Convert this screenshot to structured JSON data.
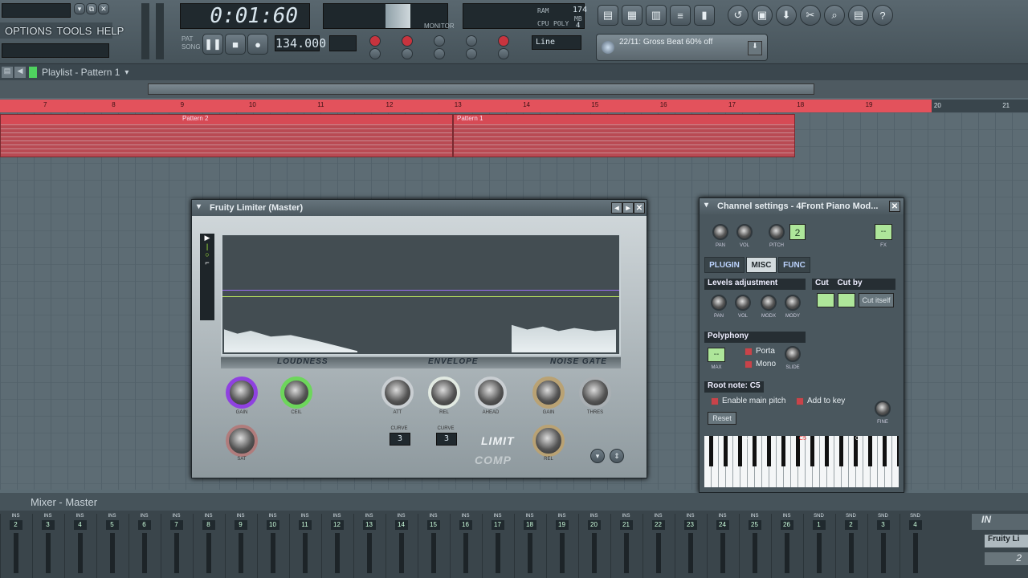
{
  "menu": {
    "options": "OPTIONS",
    "tools": "TOOLS",
    "help": "HELP"
  },
  "transport": {
    "time": "0:01:60",
    "tempo": "134.000",
    "pat_label": "PAT",
    "song_label": "SONG",
    "snap": "Line",
    "cpu_value": "174",
    "poly_value": "4",
    "ram_label": "RAM",
    "cpu_label": "CPU",
    "poly_label": "POLY",
    "mb_label": "MB",
    "hint_text": "22/11: Gross Beat 60% off",
    "monitor_label": "MONITOR"
  },
  "playlist": {
    "title": "Playlist - Pattern 1",
    "ruler": [
      "7",
      "8",
      "9",
      "10",
      "11",
      "12",
      "13",
      "14",
      "15",
      "16",
      "17",
      "18",
      "19",
      "20",
      "21"
    ],
    "patterns": [
      {
        "name": "Pattern 2"
      },
      {
        "name": "Pattern 1"
      }
    ]
  },
  "limiter": {
    "title": "Fruity Limiter (Master)",
    "sections": [
      "LOUDNESS",
      "ENVELOPE",
      "NOISE GATE"
    ],
    "knobs": [
      "GAIN",
      "CEIL",
      "ATT",
      "REL",
      "AHEAD",
      "GAIN",
      "THRES",
      "SAT",
      "REL"
    ],
    "curve_label": "CURVE",
    "curve1": "3",
    "curve2": "3",
    "mode_limit": "LIMIT",
    "mode_comp": "COMP"
  },
  "channel": {
    "title": "Channel settings - 4Front Piano Mod...",
    "knobs_top": [
      "PAN",
      "VOL",
      "PITCH"
    ],
    "pitch_range": "2",
    "fx_label": "FX",
    "fx_value": "--",
    "tabs": [
      "PLUGIN",
      "MISC",
      "FUNC"
    ],
    "levels_title": "Levels adjustment",
    "levels_knobs": [
      "PAN",
      "VOL",
      "MODX",
      "MODY"
    ],
    "cut_label": "Cut",
    "cutby_label": "Cut by",
    "cut_itself": "Cut itself",
    "polyphony_title": "Polyphony",
    "max_label": "MAX",
    "max_value": "--",
    "porta": "Porta",
    "mono": "Mono",
    "slide": "SLIDE",
    "root_note": "Root note: C5",
    "enable_main_pitch": "Enable main pitch",
    "add_to_key": "Add to key",
    "fine": "FINE",
    "reset": "Reset",
    "keys": [
      "C4",
      "C5",
      "C6"
    ]
  },
  "mixer": {
    "title": "Mixer - Master",
    "strips": [
      "2",
      "3",
      "4",
      "5",
      "6",
      "7",
      "8",
      "9",
      "10",
      "11",
      "12",
      "13",
      "14",
      "15",
      "16",
      "17",
      "18",
      "19",
      "20",
      "21",
      "22",
      "23",
      "24",
      "25",
      "26",
      "1",
      "2",
      "3",
      "4"
    ],
    "strip_labels": [
      "INS",
      "INS",
      "INS",
      "INS",
      "INS",
      "INS",
      "INS",
      "INS",
      "INS",
      "INS",
      "INS",
      "INS",
      "INS",
      "INS",
      "INS",
      "INS",
      "INS",
      "INS",
      "INS",
      "INS",
      "INS",
      "INS",
      "INS",
      "INS",
      "INS",
      "SND",
      "SND",
      "SND",
      "SND"
    ],
    "in_label": "IN",
    "slot_label": "Fruity Li",
    "slot_num": "2"
  }
}
